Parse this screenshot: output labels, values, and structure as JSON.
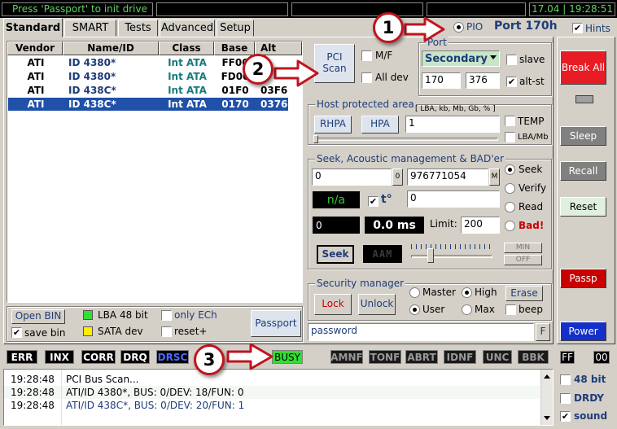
{
  "status_bar": {
    "message": "Press 'Passport' to init drive",
    "date": "17.04",
    "time": "19:28:51"
  },
  "tabs": [
    "Standard",
    "SMART",
    "Tests",
    "Advanced",
    "Setup"
  ],
  "pio": {
    "label": "PIO",
    "port": "Port 170h"
  },
  "hints_label": "Hints",
  "drive_table": {
    "headers": [
      "Vendor",
      "Name/ID",
      "Class",
      "Base",
      "Alt"
    ],
    "rows": [
      [
        "ATI",
        "ID 4380*",
        "Int ATA",
        "FF00",
        ""
      ],
      [
        "ATI",
        "ID 4380*",
        "Int ATA",
        "FD00",
        ""
      ],
      [
        "ATI",
        "ID 438C*",
        "Int ATA",
        "01F0",
        "03F6"
      ],
      [
        "ATI",
        "ID 438C*",
        "Int ATA",
        "0170",
        "0376"
      ]
    ]
  },
  "pci_scan": {
    "button": "PCI Scan",
    "mf": "M/F",
    "all_dev": "All dev"
  },
  "port_group": {
    "title": "Port",
    "channel": "Secondary",
    "slave": "slave",
    "base": "170",
    "alt": "376",
    "alt_st": "alt-st"
  },
  "hpa_group": {
    "title": "Host protected area",
    "units": "[ LBA, kb, Mb, Gb, % ]",
    "rhpa": "RHPA",
    "hpa": "HPA",
    "value": "1",
    "temp": "TEMP",
    "lba_mb": "LBA/Mb"
  },
  "seek_group": {
    "title": "Seek, Acoustic management & BAD'er",
    "start": "0",
    "start_btn": "0",
    "end": "976771054",
    "end_btn": "M",
    "na": "n/a",
    "t_label": "t°",
    "t_value": "0",
    "counter": "0",
    "time": "0.0 ms",
    "limit_label": "Limit:",
    "limit": "200",
    "radios": [
      "Seek",
      "Verify",
      "Read",
      "Bad!"
    ],
    "seek_btn": "Seek",
    "aam": "AAM",
    "min": "MIN",
    "off": "OFF"
  },
  "security_group": {
    "title": "Security manager",
    "lock": "Lock",
    "unlock": "Unlock",
    "master": "Master",
    "high": "High",
    "erase": "Erase",
    "user": "User",
    "max": "Max",
    "beep": "beep",
    "password": "password",
    "f_btn": "F"
  },
  "bottom_left": {
    "open_bin": "Open BIN",
    "save_bin": "save bin",
    "lba48": "LBA 48 bit",
    "sata": "SATA dev",
    "only_ech": "only ECh",
    "reset_plus": "reset+",
    "passport": "Passport"
  },
  "right_buttons": {
    "break_all": "Break All",
    "sleep": "Sleep",
    "recall": "Recall",
    "reset": "Reset",
    "passp": "Passp",
    "power": "Power"
  },
  "status_flags": [
    "ERR",
    "INX",
    "CORR",
    "DRQ",
    "DRSC",
    "BUSY",
    "AMNF",
    "TONF",
    "ABRT",
    "IDNF",
    "UNC",
    "BBK"
  ],
  "ff_values": [
    "FF",
    "00"
  ],
  "log": [
    {
      "time": "19:28:48",
      "text": "PCI Bus Scan..."
    },
    {
      "time": "19:28:48",
      "text": "ATI/ID 4380*, BUS: 0/DEV: 18/FUN: 0"
    },
    {
      "time": "19:28:48",
      "text": "ATI/ID 438C*, BUS: 0/DEV: 20/FUN: 1"
    }
  ],
  "bottom_right": {
    "bit48": "48 bit",
    "drdy": "DRDY",
    "sound": "sound"
  },
  "callouts": [
    "1",
    "2",
    "3"
  ],
  "colors": {
    "accent": "#1e3c78",
    "busy": "#33dd33",
    "break": "#e81c24",
    "passp": "#c80000",
    "power": "#1430c8",
    "callout": "#c0141e"
  }
}
